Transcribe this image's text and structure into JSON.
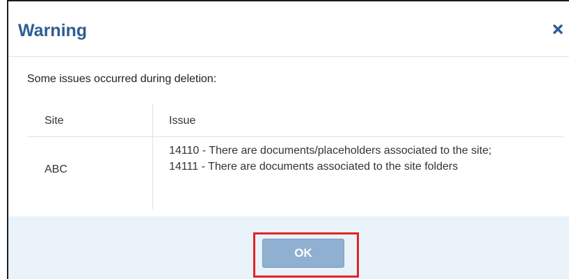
{
  "dialog": {
    "title": "Warning",
    "close_icon": "close-icon",
    "message": "Some issues occurred during deletion:"
  },
  "table": {
    "columns": [
      "Site",
      "Issue"
    ],
    "rows": [
      {
        "site": "ABC",
        "issues": [
          "14110 - There are documents/placeholders associated to the site;",
          "14111 - There are documents associated to the site folders"
        ]
      }
    ]
  },
  "footer": {
    "ok_label": "OK"
  },
  "colors": {
    "title": "#2e5e93",
    "footer_bg": "#eaf2fa",
    "ok_button": "#8fb0d0",
    "highlight": "#e02424"
  }
}
